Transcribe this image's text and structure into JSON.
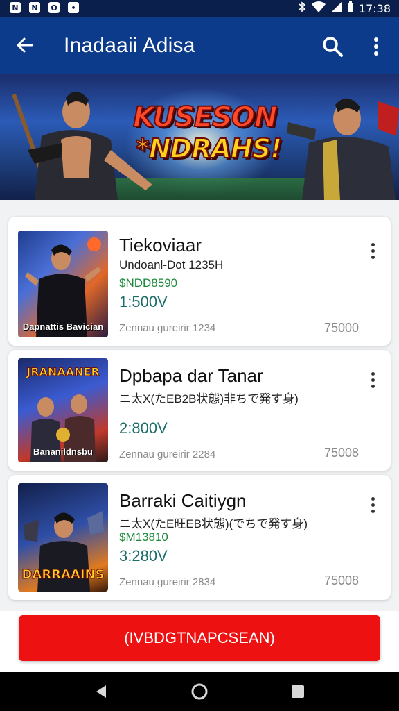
{
  "status_bar": {
    "time": "17:38",
    "left_icons": [
      "N",
      "N",
      "O",
      "•"
    ],
    "right_icons": [
      "bluetooth-icon",
      "wifi-icon",
      "signal-icon",
      "battery-icon"
    ]
  },
  "app_bar": {
    "title": "Inadaaii Adisa",
    "back_icon": "arrow-left-icon",
    "search_icon": "search-icon",
    "more_icon": "more-vert-icon"
  },
  "banner": {
    "line1": "KUSESON",
    "line2": "*NDRAHS!"
  },
  "cards": [
    {
      "title": "Tiekoviaar",
      "subtitle": "Undoanl-Dot 1235H",
      "highlight": "$NDD8590",
      "price": "1:500V",
      "meta": "Zennau gureirir 1234",
      "count": "75000",
      "thumb_caption": "Dapnattis Bavician",
      "thumb_logo": ""
    },
    {
      "title": "Dpbapa dar Tanar",
      "subtitle": "ニ太X(たEB2B状態)非ちで発す身)",
      "highlight": "",
      "price": "2:800V",
      "meta": "Zennau gureirir 2284",
      "count": "75008",
      "thumb_caption": "Bananildnsbu",
      "thumb_logo": "JRANAANER"
    },
    {
      "title": "Barraki Caitiygn",
      "subtitle": "ニ太X(たE旺EB状態)(でちで発す身)",
      "highlight": "$M13810",
      "price": "3:280V",
      "meta": "Zennau gureirir 2834",
      "count": "75008",
      "thumb_caption": "",
      "thumb_logo": "DARRAAINS"
    }
  ],
  "cta": {
    "label": "(IVBDGTNAPCSEAN)"
  },
  "nav_bar": {
    "back_icon": "triangle-back-icon",
    "home_icon": "circle-home-icon",
    "recents_icon": "square-recents-icon"
  },
  "colors": {
    "app_bar": "#0d3b8c",
    "status_bar": "#0b1f4d",
    "cta": "#ee1111",
    "highlight_green": "#1c8a3a",
    "price_teal": "#1b6d6a"
  }
}
